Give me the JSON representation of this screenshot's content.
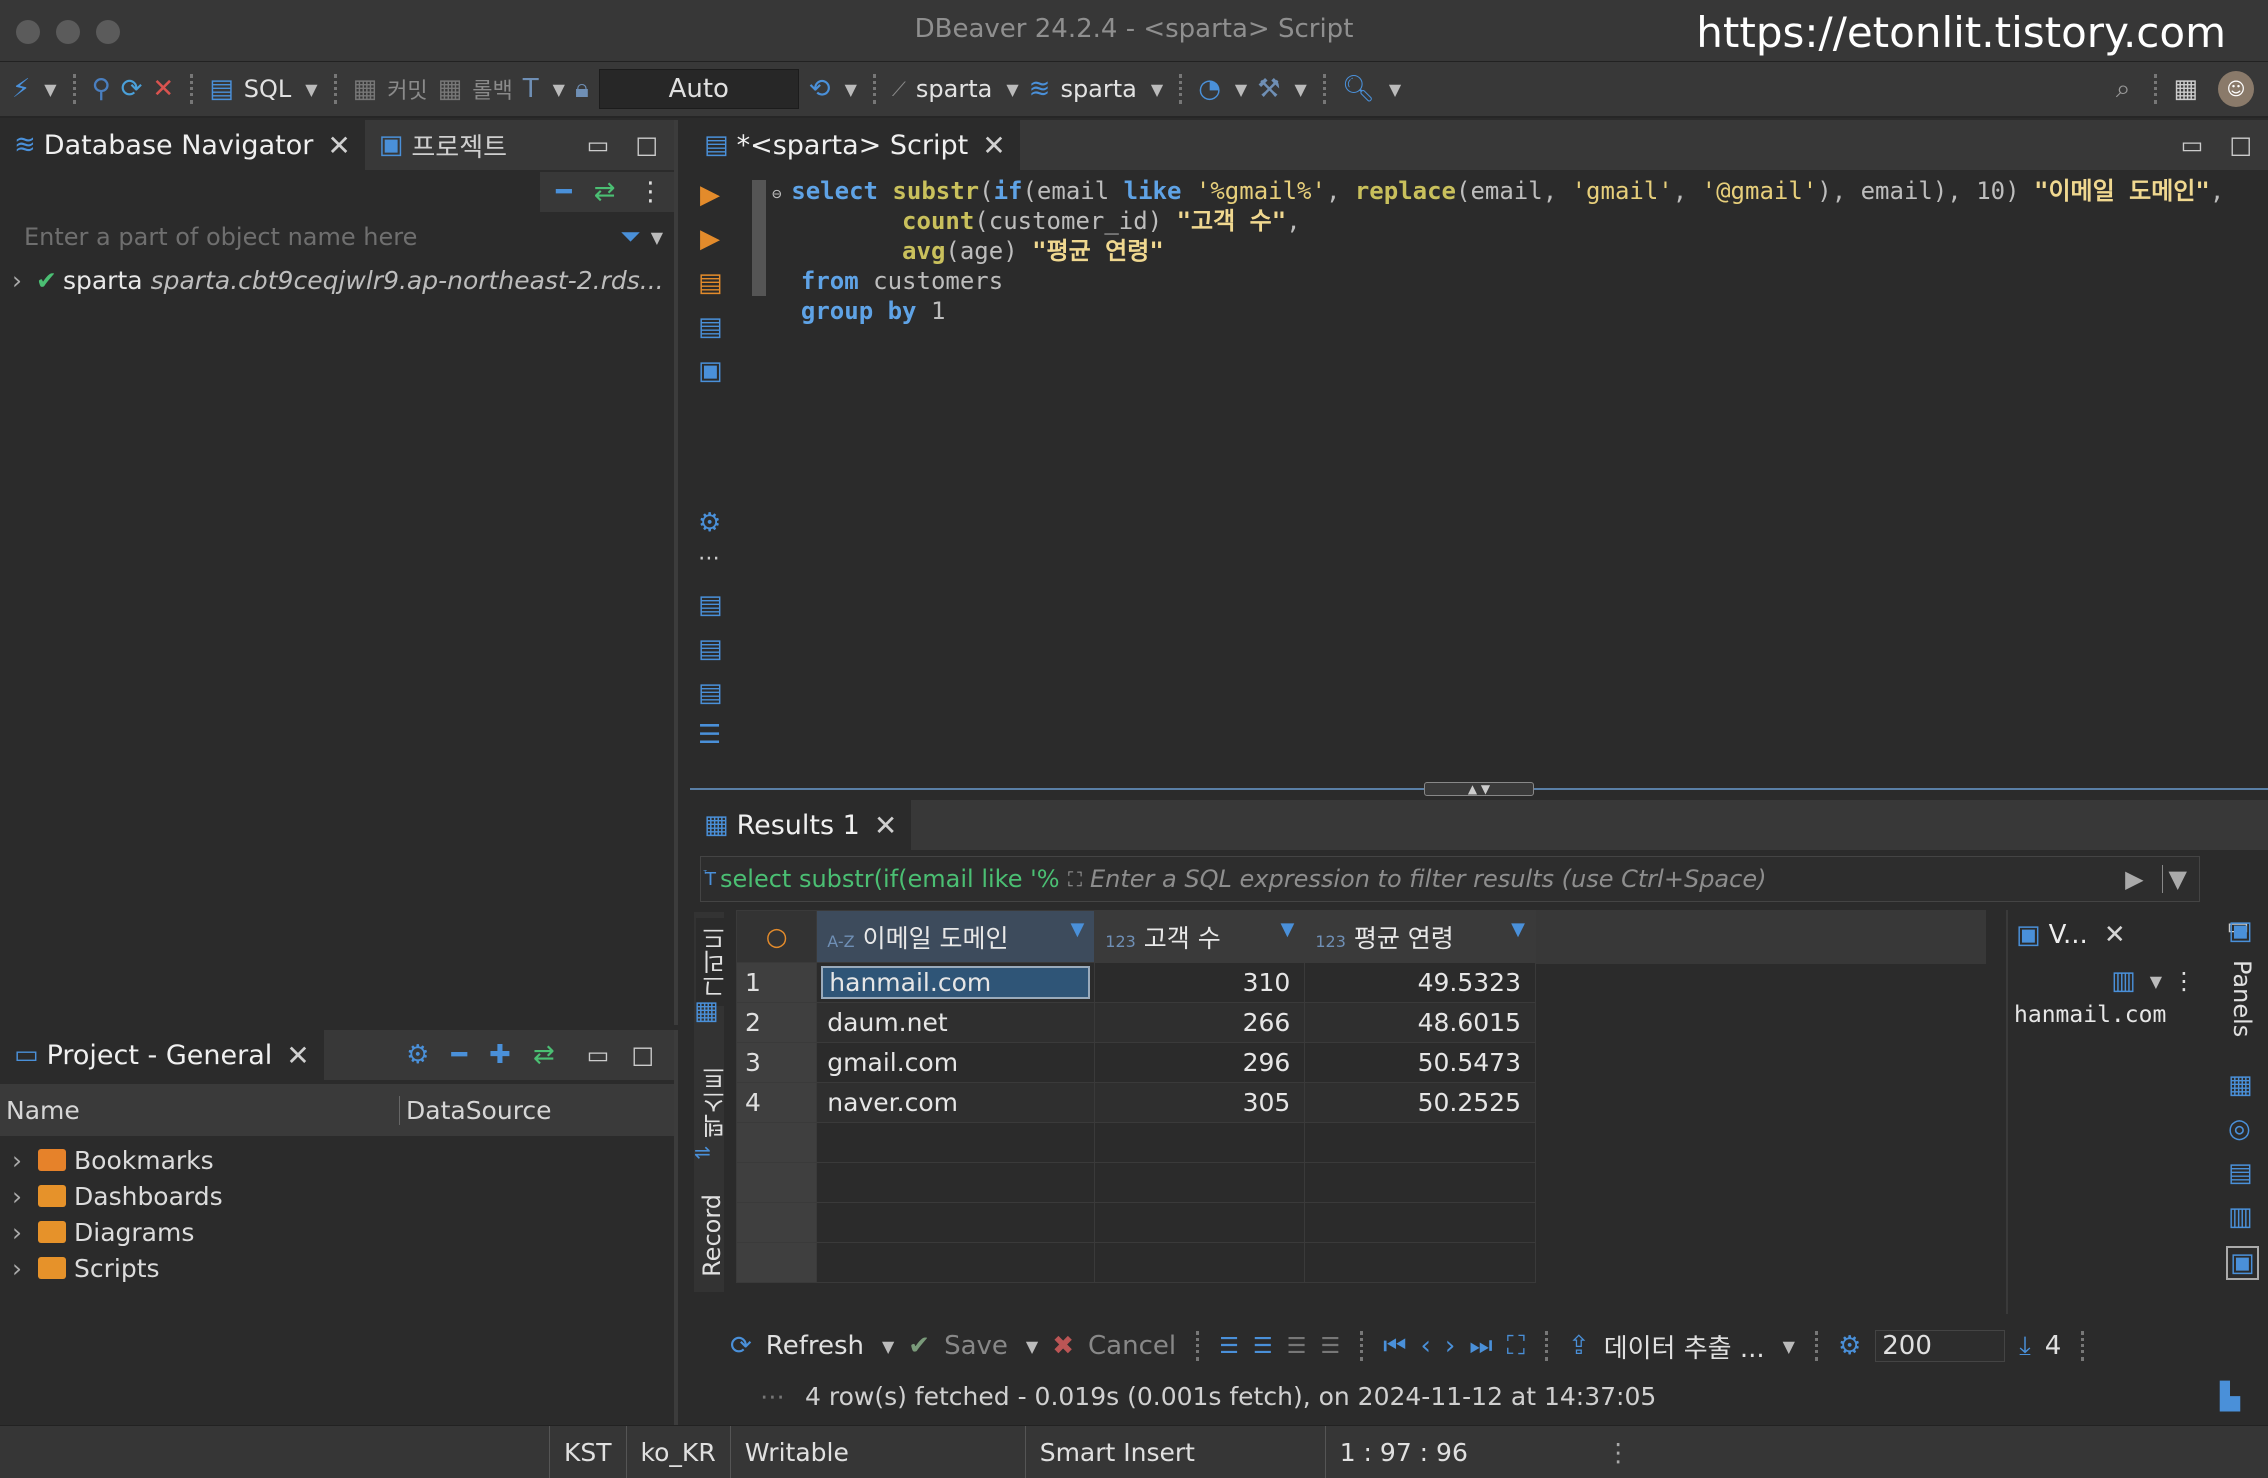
{
  "window": {
    "title": "DBeaver 24.2.4 - <sparta> Script",
    "watermark": "https://etonlit.tistory.com"
  },
  "toolbar": {
    "sql_label": "SQL",
    "commit_label": "커밋",
    "rollback_label": "롤백",
    "transaction_mode": "Auto",
    "connection": "sparta",
    "schema": "sparta"
  },
  "navigator": {
    "tab_label": "Database Navigator",
    "project_tab_label": "프로젝트",
    "filter_placeholder": "Enter a part of object name here",
    "connection_name": "sparta",
    "connection_host": "sparta.cbt9ceqjwlr9.ap-northeast-2.rds..."
  },
  "project": {
    "tab_label": "Project - General",
    "columns": [
      "Name",
      "DataSource"
    ],
    "items": [
      {
        "label": "Bookmarks",
        "color": "#e6822a"
      },
      {
        "label": "Dashboards",
        "color": "#e6922a"
      },
      {
        "label": "Diagrams",
        "color": "#e6922a"
      },
      {
        "label": "Scripts",
        "color": "#e6922a"
      }
    ]
  },
  "editor": {
    "tab_label": "*<sparta> Script"
  },
  "results": {
    "tab_label": "Results 1",
    "query_preview": "select substr(if(email like '%",
    "filter_placeholder": "Enter a SQL expression to filter results (use Ctrl+Space)",
    "side_tabs": [
      "그리드",
      "텍스트",
      "Record"
    ],
    "columns": [
      {
        "type": "A-Z",
        "label": "이메일 도메인"
      },
      {
        "type": "123",
        "label": "고객 수"
      },
      {
        "type": "123",
        "label": "평균 연령"
      }
    ],
    "rows": [
      {
        "num": "1",
        "domain": "hanmail.com",
        "count": "310",
        "age": "49.5323"
      },
      {
        "num": "2",
        "domain": "daum.net",
        "count": "266",
        "age": "48.6015"
      },
      {
        "num": "3",
        "domain": "gmail.com",
        "count": "296",
        "age": "50.5473"
      },
      {
        "num": "4",
        "domain": "naver.com",
        "count": "305",
        "age": "50.2525"
      }
    ],
    "value_panel": {
      "title": "V...",
      "value": "hanmail.com",
      "panels_label": "Panels"
    },
    "bottom": {
      "refresh": "Refresh",
      "save": "Save",
      "cancel": "Cancel",
      "export": "데이터 추출 ...",
      "fetch_size": "200",
      "row_count": "4",
      "fetch_status": "4 row(s) fetched - 0.019s (0.001s fetch), on 2024-11-12 at 14:37:05"
    }
  },
  "statusbar": {
    "timezone": "KST",
    "locale": "ko_KR",
    "mode": "Writable",
    "insert": "Smart Insert",
    "position": "1 : 97 : 96"
  }
}
